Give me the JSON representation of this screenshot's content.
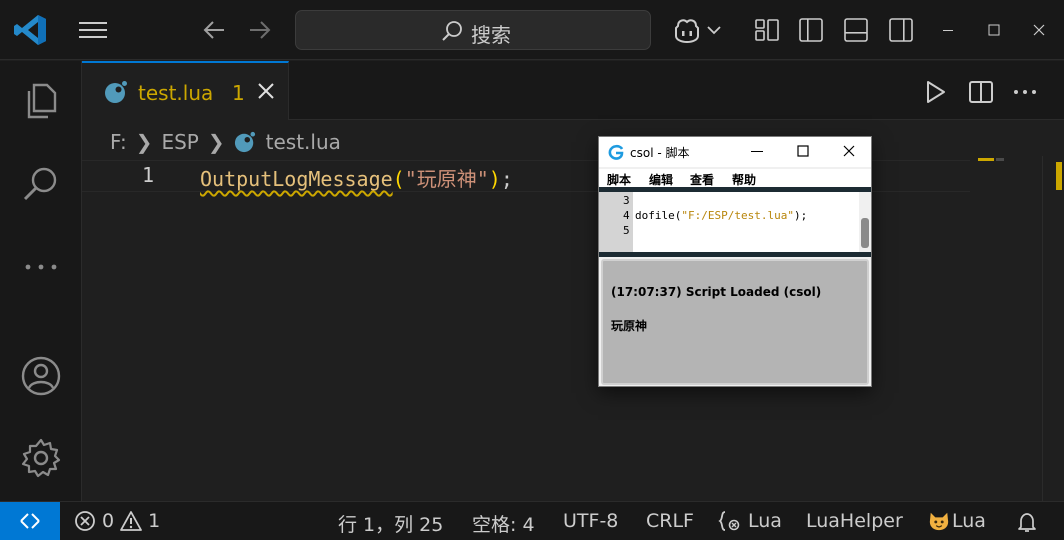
{
  "titlebar": {
    "search_placeholder": "搜索"
  },
  "tab": {
    "filename": "test.lua",
    "problem_count": "1"
  },
  "breadcrumb": {
    "drive": "F:",
    "folder": "ESP",
    "file": "test.lua"
  },
  "editor": {
    "line_number": "1",
    "code_function": "OutputLogMessage",
    "code_open": "(",
    "code_string": "\"玩原神\"",
    "code_close": ")",
    "code_semicolon": ";"
  },
  "statusbar": {
    "errors": "0",
    "warnings": "1",
    "position": "行 1，列 25",
    "spaces": "空格: 4",
    "encoding": "UTF-8",
    "eol": "CRLF",
    "language": "Lua",
    "extension": "LuaHelper",
    "lua_ext": "Lua"
  },
  "script_window": {
    "title": "csol - 脚本",
    "menu": [
      "脚本",
      "编辑",
      "查看",
      "帮助"
    ],
    "line_numbers": [
      "3",
      "4",
      "5"
    ],
    "code_prefix": "dofile(",
    "code_string": "\"F:/ESP/test.lua\"",
    "code_suffix": ");",
    "output_line1": "(17:07:37) Script Loaded (csol)",
    "output_line2": "玩原神"
  },
  "colors": {
    "accent": "#0078d4",
    "warning": "#cca700",
    "background": "#1f1f1f",
    "sidebar": "#181818"
  }
}
